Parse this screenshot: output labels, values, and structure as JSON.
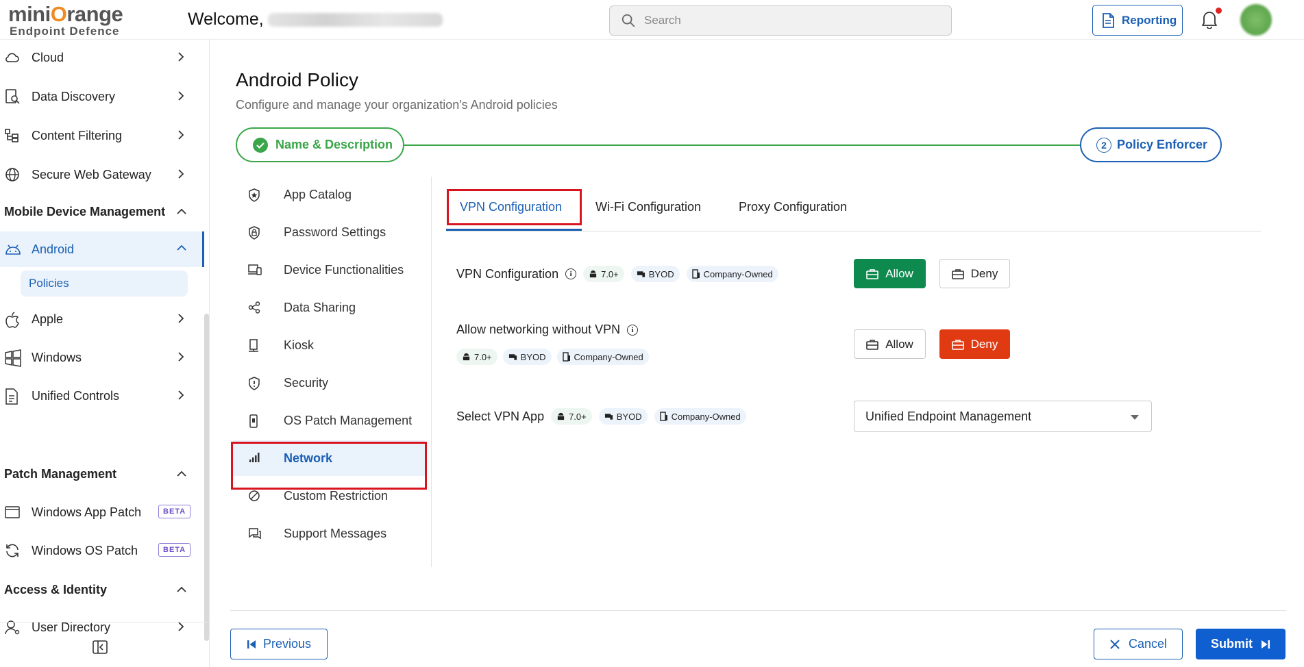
{
  "header": {
    "logo_main_pre": "mini",
    "logo_main_o": "O",
    "logo_main_post": "range",
    "logo_sub": "Endpoint Defence",
    "welcome": "Welcome,",
    "search_placeholder": "Search",
    "reporting_label": "Reporting"
  },
  "sidebar": {
    "items": [
      {
        "label": "Cloud",
        "icon": "cloud-icon"
      },
      {
        "label": "Data Discovery",
        "icon": "data-discovery-icon"
      },
      {
        "label": "Content Filtering",
        "icon": "content-filter-icon"
      },
      {
        "label": "Secure Web Gateway",
        "icon": "globe-icon"
      }
    ],
    "section_mdm": "Mobile Device Management",
    "android_label": "Android",
    "policies_label": "Policies",
    "mdm_items": [
      {
        "label": "Apple",
        "icon": "apple-icon"
      },
      {
        "label": "Windows",
        "icon": "windows-icon"
      },
      {
        "label": "Unified Controls",
        "icon": "document-icon"
      }
    ],
    "section_patch": "Patch Management",
    "patch_items": [
      {
        "label": "Windows App Patch",
        "badge": "BETA"
      },
      {
        "label": "Windows OS Patch",
        "badge": "BETA"
      }
    ],
    "section_access": "Access & Identity",
    "user_directory": "User Directory"
  },
  "page": {
    "title": "Android Policy",
    "subtitle": "Configure and manage your organization's Android policies",
    "step1": "Name & Description",
    "step2_num": "2",
    "step2": "Policy Enforcer"
  },
  "categories": [
    "App Catalog",
    "Password Settings",
    "Device Functionalities",
    "Data Sharing",
    "Kiosk",
    "Security",
    "OS Patch Management",
    "Network",
    "Custom Restriction",
    "Support Messages"
  ],
  "tabs": [
    "VPN Configuration",
    "Wi-Fi Configuration",
    "Proxy Configuration"
  ],
  "settings": {
    "row1_label": "VPN Configuration",
    "row2_label": "Allow networking without VPN",
    "row3_label": "Select VPN App",
    "chip_version": "7.0+",
    "chip_byod": "BYOD",
    "chip_company": "Company-Owned",
    "allow": "Allow",
    "deny": "Deny",
    "vpn_app_value": "Unified Endpoint Management"
  },
  "footer": {
    "previous": "Previous",
    "cancel": "Cancel",
    "submit": "Submit"
  },
  "colors": {
    "primary": "#1a5fb4",
    "success": "#0e8a4f",
    "danger": "#e03a13",
    "highlight_box": "#d8141f"
  }
}
